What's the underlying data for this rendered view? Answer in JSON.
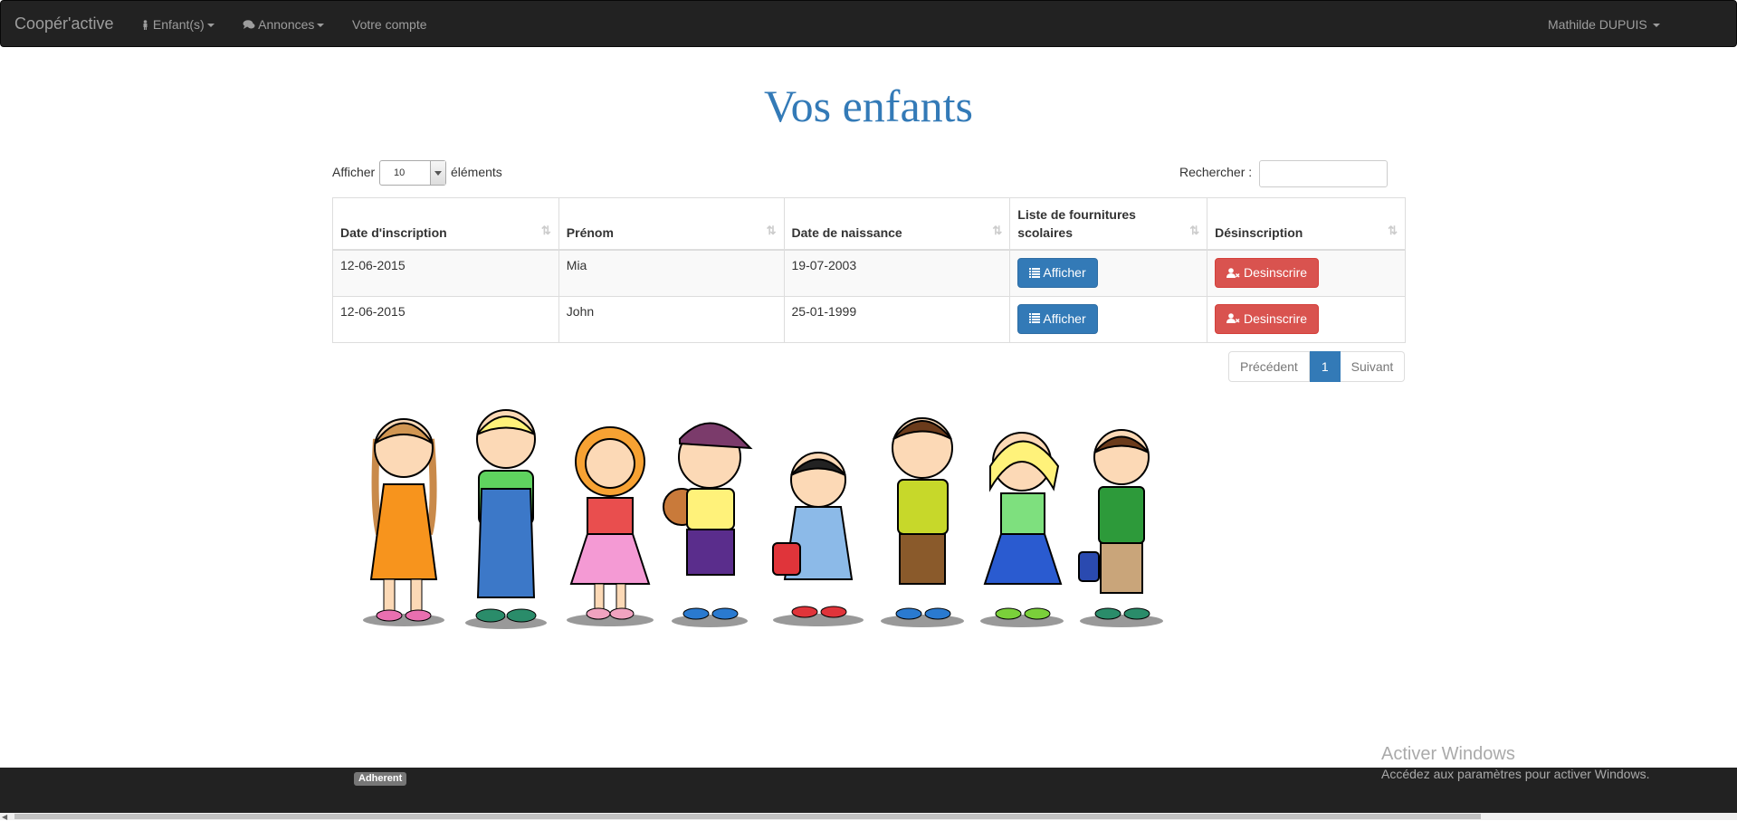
{
  "navbar": {
    "brand": "Coopér'active",
    "items": [
      {
        "label": "Enfant(s)"
      },
      {
        "label": "Annonces"
      },
      {
        "label": "Votre compte"
      }
    ],
    "user": "Mathilde DUPUIS"
  },
  "page": {
    "title": "Vos enfants"
  },
  "table_controls": {
    "length_prefix": "Afficher",
    "length_value": "10",
    "length_suffix": "éléments",
    "search_label": "Rechercher :",
    "search_value": ""
  },
  "table": {
    "headers": [
      "Date d'inscription",
      "Prénom",
      "Date de naissance",
      "Liste de fournitures scolaires",
      "Désinscription"
    ],
    "rows": [
      {
        "date_inscription": "12-06-2015",
        "prenom": "Mia",
        "date_naissance": "19-07-2003",
        "afficher": "Afficher",
        "desinscrire": "Desinscrire"
      },
      {
        "date_inscription": "12-06-2015",
        "prenom": "John",
        "date_naissance": "25-01-1999",
        "afficher": "Afficher",
        "desinscrire": "Desinscrire"
      }
    ]
  },
  "pagination": {
    "previous": "Précédent",
    "current": "1",
    "next": "Suivant"
  },
  "footer": {
    "badge": "Adherent"
  },
  "watermark": {
    "line1": "Activer Windows",
    "line2": "Accédez aux paramètres pour activer Windows."
  },
  "colors": {
    "primary": "#337ab7",
    "danger": "#d9534f",
    "navbar": "#222222"
  }
}
